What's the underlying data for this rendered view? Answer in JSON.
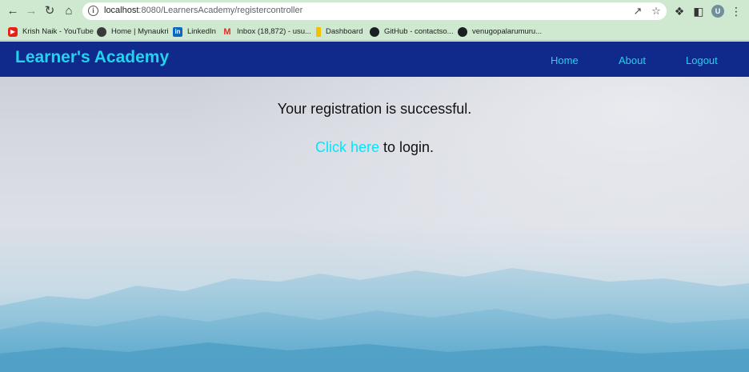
{
  "browser": {
    "url_host": "localhost",
    "url_path": ":8080/LearnersAcademy/registercontroller",
    "avatar_letter": "U"
  },
  "bookmarks": [
    {
      "label": "Krish Naik - YouTube",
      "icon": "youtube-icon"
    },
    {
      "label": "Home | Mynaukri",
      "icon": "globe-icon"
    },
    {
      "label": "LinkedIn",
      "icon": "linkedin-icon"
    },
    {
      "label": "Inbox (18,872) - usu...",
      "icon": "gmail-icon"
    },
    {
      "label": "Dashboard",
      "icon": "dashboard-icon"
    },
    {
      "label": "GitHub - contactso...",
      "icon": "github-icon"
    },
    {
      "label": "venugopalarumuru...",
      "icon": "github-icon"
    }
  ],
  "navbar": {
    "brand": "Learner's Academy",
    "links": [
      "Home",
      "About",
      "Logout"
    ]
  },
  "main": {
    "message": "Your registration is successful.",
    "link_text": "Click here",
    "link_suffix": " to login."
  },
  "colors": {
    "navbar": "#0f2a8a",
    "accent": "#22d3ee",
    "link": "#00e5ff"
  }
}
